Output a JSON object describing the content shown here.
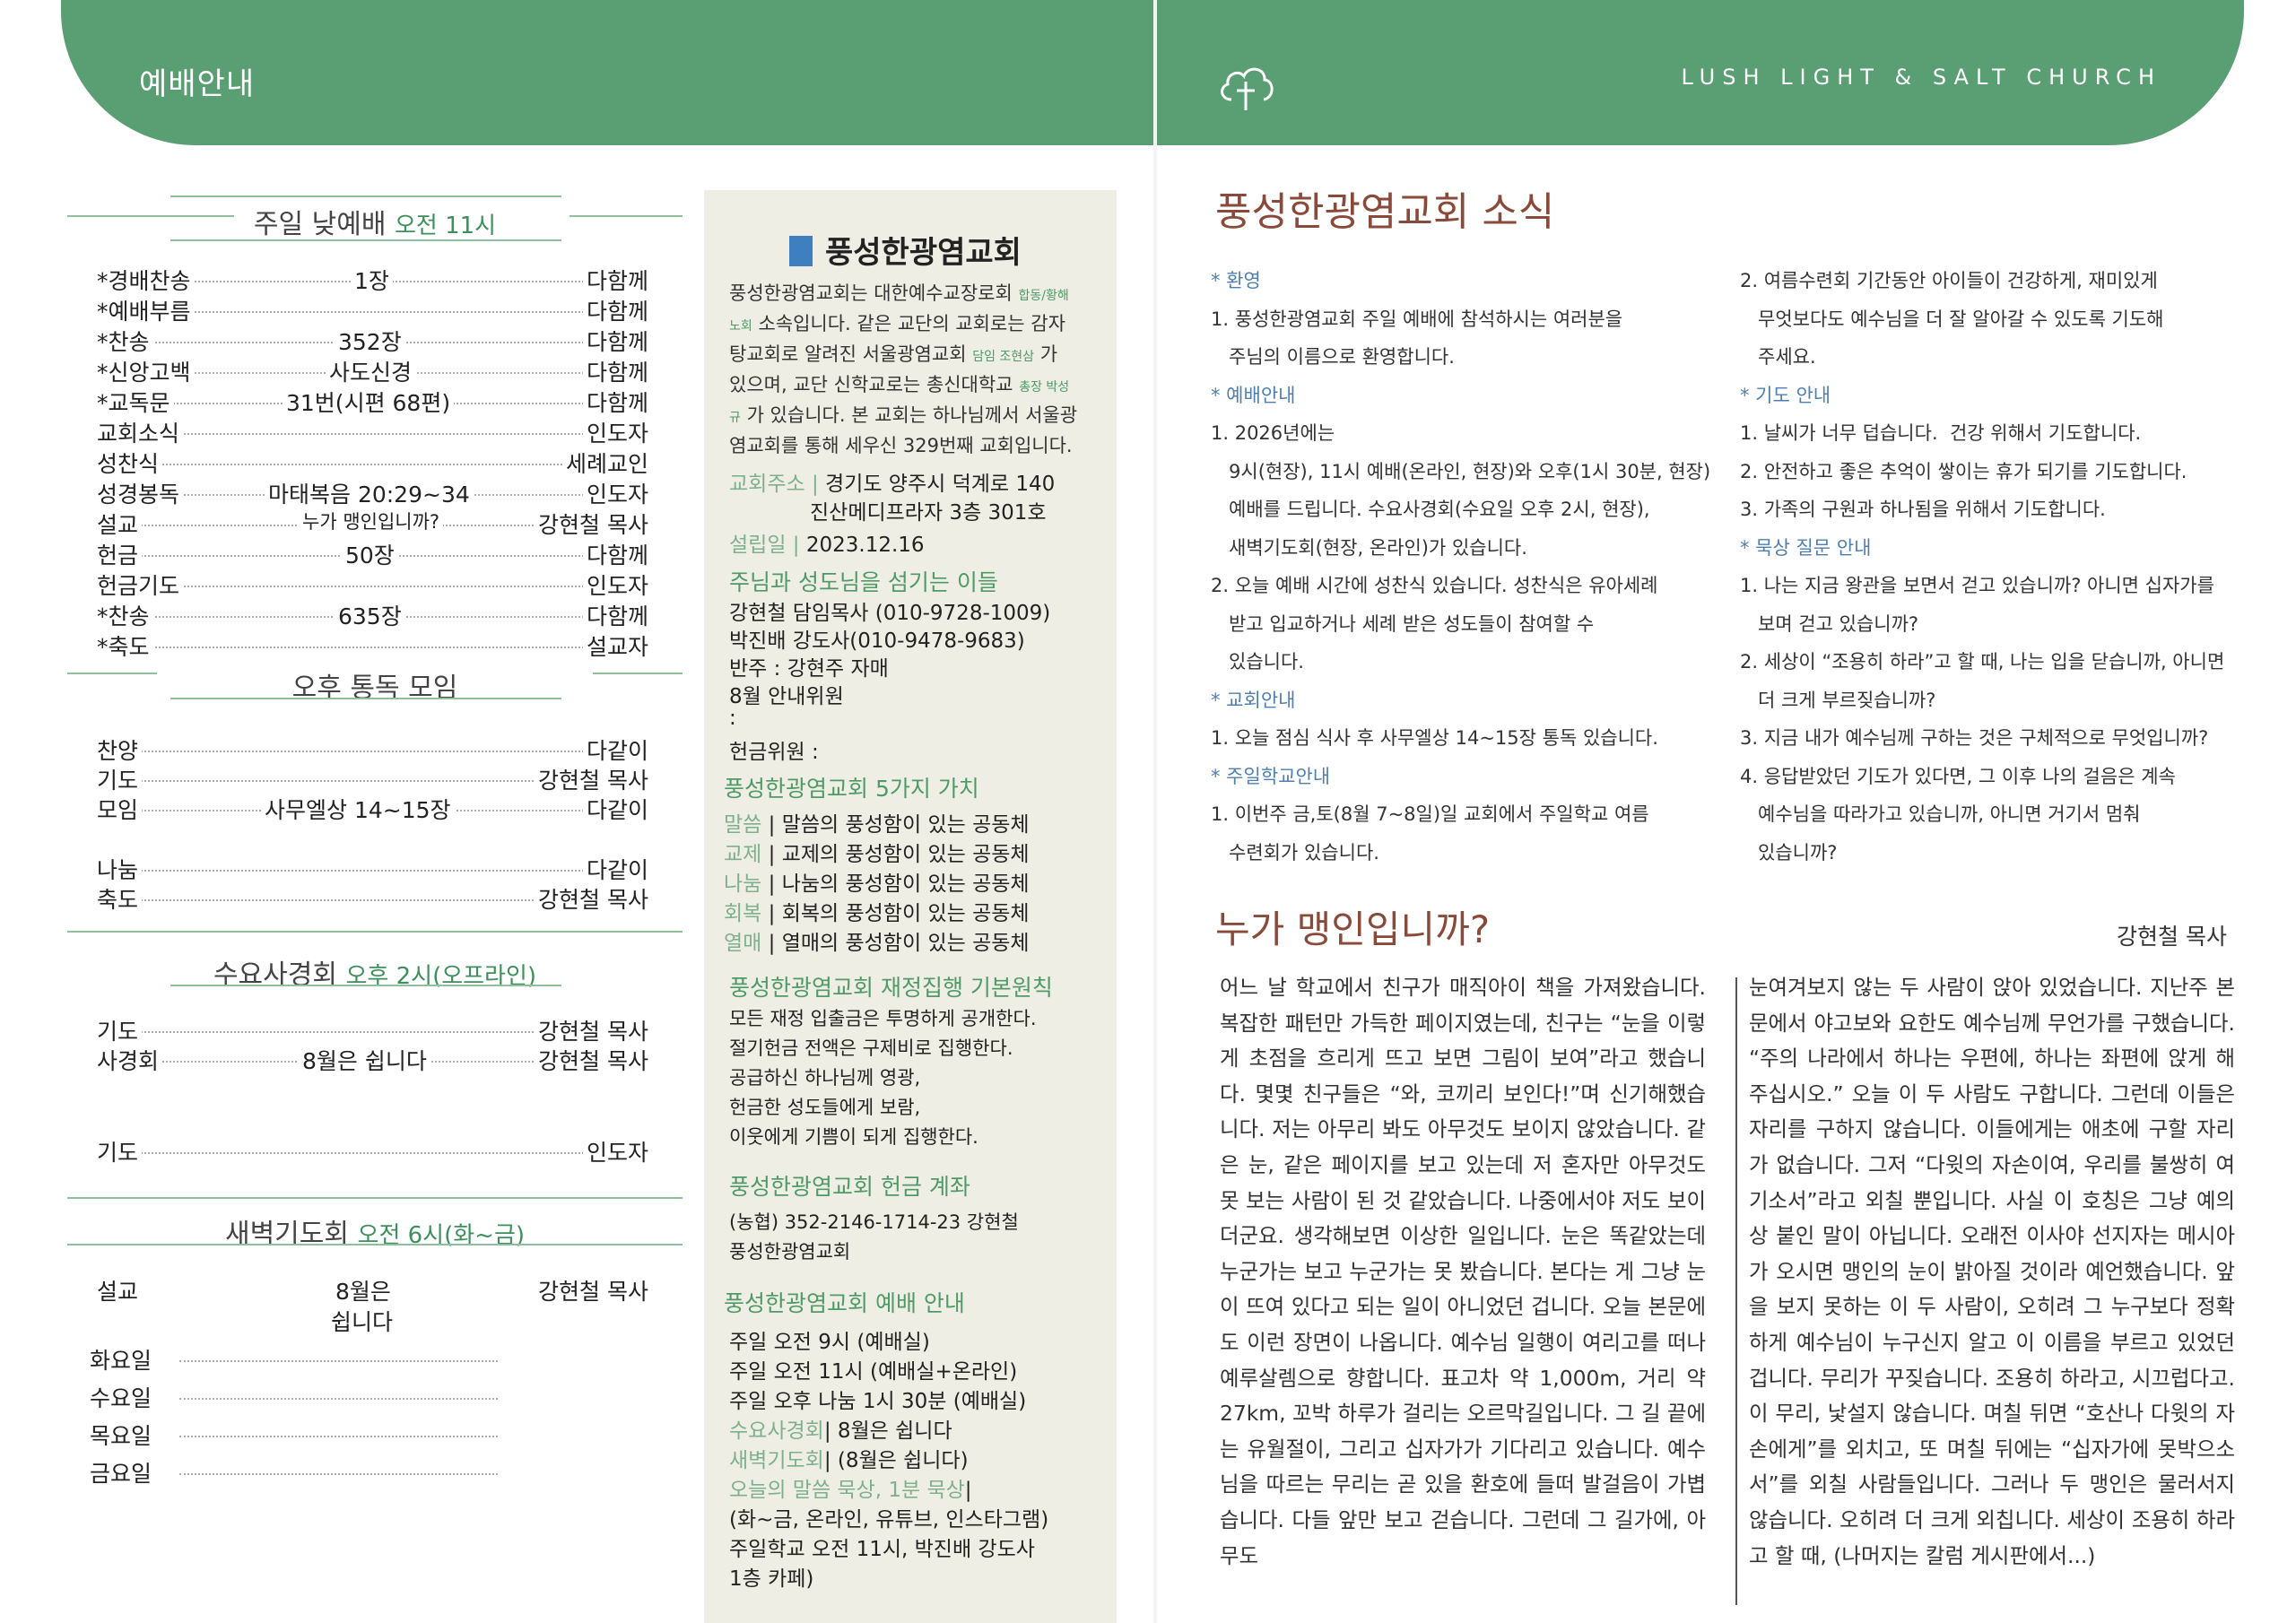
{
  "header": {
    "left_label": "예배안내",
    "church_en": "LUSH LIGHT & SALT CHURCH"
  },
  "sunday": {
    "title": "주일 낮예배",
    "time": "오전 11시",
    "rows": [
      {
        "l": "*경배찬송",
        "m": "1장",
        "r": "다함께"
      },
      {
        "l": "*예배부름",
        "m": "",
        "r": "다함께"
      },
      {
        "l": "*찬송",
        "m": "352장",
        "r": "다함께"
      },
      {
        "l": "*신앙고백",
        "m": "사도신경",
        "r": "다함께"
      },
      {
        "l": "*교독문",
        "m": "31번(시편 68편)",
        "r": "다함께"
      },
      {
        "l": "교회소식",
        "m": "",
        "r": "인도자"
      },
      {
        "l": "성찬식",
        "m": "",
        "r": "세례교인"
      },
      {
        "l": "성경봉독",
        "m": "마태복음 20:29~34",
        "r": "인도자"
      },
      {
        "l": "설교",
        "m": "누가 맹인입니까?",
        "r": "강현철 목사"
      },
      {
        "l": "헌금",
        "m": "50장",
        "r": "다함께"
      },
      {
        "l": "헌금기도",
        "m": "",
        "r": "인도자"
      },
      {
        "l": "*찬송",
        "m": "635장",
        "r": "다함께"
      },
      {
        "l": "*축도",
        "m": "",
        "r": "설교자"
      }
    ]
  },
  "afternoon": {
    "title": "오후 통독 모임",
    "rows": [
      {
        "l": "찬양",
        "m": "",
        "r": "다같이"
      },
      {
        "l": "기도",
        "m": "",
        "r": "강현철 목사"
      },
      {
        "l": "모임",
        "m": "사무엘상 14~15장",
        "r": "다같이"
      },
      {
        "l": "나눔",
        "m": "",
        "r": "다같이"
      },
      {
        "l": "축도",
        "m": "",
        "r": "강현철 목사"
      }
    ]
  },
  "wednesday": {
    "title": "수요사경회",
    "time": "오후 2시(오프라인)",
    "rows": [
      {
        "l": "기도",
        "m": "",
        "r": "강현철 목사"
      },
      {
        "l": "사경회",
        "m": "8월은 쉽니다",
        "r": "강현철 목사"
      },
      {
        "l": "기도",
        "m": "",
        "r": "인도자"
      }
    ]
  },
  "dawn": {
    "title": "새벽기도회",
    "time": "오전 6시(화~금)",
    "sermon": {
      "l": "설교",
      "m1": "8월은",
      "m2": "쉽니다",
      "r": "강현철 목사"
    },
    "days": [
      "화요일",
      "수요일",
      "목요일",
      "금요일"
    ]
  },
  "middle": {
    "logo": "풍성한광염교회",
    "intro": [
      {
        "t": "풍성한광염교회는 대한예수교장로회 ",
        "s": "합동/황해"
      },
      {
        "t": "",
        "s": "노회",
        "t2": " 소속입니다. 같은 교단의 교회로는 감자"
      },
      {
        "t": "탕교회로 알려진 서울광염교회 ",
        "s": "담임 조현삼",
        "t2": " 가"
      },
      {
        "t": "있으며, 교단 신학교로는 총신대학교 ",
        "s": "총장 박성"
      },
      {
        "t": "",
        "s": "규",
        "t2": " 가 있습니다. 본 교회는 하나님께서 서울광"
      },
      {
        "t": "염교회를 통해 세우신 329번째 교회입니다."
      }
    ],
    "address_label": "교회주소 |",
    "address1": "경기도 양주시 덕계로 140",
    "address2": "진산메디프라자 3층 301호",
    "founded_label": "설립일 |",
    "founded": "2023.12.16",
    "servants_title": "주님과 성도님을 섬기는 이들",
    "servants": [
      "강현철 담임목사 (010-9728-1009)",
      "박진배 강도사(010-9478-9683)",
      "반주 : 강현주 자매",
      "8월 안내위원",
      ":",
      "헌금위원 :"
    ],
    "values_title": "풍성한광염교회 5가지 가치",
    "values": [
      {
        "k": "말씀",
        "v": "| 말씀의 풍성함이 있는 공동체"
      },
      {
        "k": "교제",
        "v": "| 교제의 풍성함이 있는 공동체"
      },
      {
        "k": "나눔",
        "v": "| 나눔의 풍성함이 있는 공동체"
      },
      {
        "k": "회복",
        "v": "| 회복의 풍성함이 있는 공동체"
      },
      {
        "k": "열매",
        "v": "| 열매의 풍성함이 있는 공동체"
      }
    ],
    "finance_title": "풍성한광염교회 재정집행 기본원칙",
    "finance": [
      "모든 재정 입출금은 투명하게 공개한다.",
      "절기헌금 전액은 구제비로 집행한다.",
      "공급하신 하나님께 영광,",
      "헌금한 성도들에게 보람,",
      "이웃에게 기쁨이 되게 집행한다."
    ],
    "account_title": "풍성한광염교회 헌금 계좌",
    "account": [
      "(농협) 352-2146-1714-23 강현철",
      "풍성한광염교회"
    ],
    "worship_title": "풍성한광염교회 예배 안내",
    "worship": [
      {
        "k": "",
        "v": "주일 오전 9시 (예배실)"
      },
      {
        "k": "",
        "v": "주일 오전 11시 (예배실+온라인)"
      },
      {
        "k": "",
        "v": "주일 오후 나눔 1시 30분 (예배실)"
      },
      {
        "k": "수요사경회",
        "v": "| 8월은 쉽니다"
      },
      {
        "k": "새벽기도회",
        "v": "| (8월은 쉽니다)"
      },
      {
        "k": "오늘의 말씀 묵상, 1분 묵상",
        "v": "|"
      },
      {
        "k": "",
        "v": "(화~금, 온라인, 유튜브, 인스타그램)"
      },
      {
        "k": "",
        "v": "주일학교 오전 11시, 박진배 강도사"
      },
      {
        "k": "",
        "v": "1층 카페)"
      }
    ]
  },
  "news": {
    "title": "풍성한광염교회 소식",
    "left": [
      {
        "h": "* 환영"
      },
      {
        "t": "1. 풍성한광염교회 주일 예배에 참석하시는 여러분을"
      },
      {
        "t": "   주님의 이름으로 환영합니다."
      },
      {
        "h": "* 예배안내"
      },
      {
        "t": "1. 2026년에는"
      },
      {
        "t": "   9시(현장), 11시 예배(온라인, 현장)와 오후(1시 30분, 현장)"
      },
      {
        "t": "   예배를 드립니다. 수요사경회(수요일 오후 2시, 현장),"
      },
      {
        "t": "   새벽기도회(현장, 온라인)가 있습니다."
      },
      {
        "t": "2. 오늘 예배 시간에 성찬식 있습니다. 성찬식은 유아세례"
      },
      {
        "t": "   받고 입교하거나 세례 받은 성도들이 참여할 수"
      },
      {
        "t": "   있습니다."
      },
      {
        "h": "* 교회안내"
      },
      {
        "t": "1. 오늘 점심 식사 후 사무엘상 14~15장 통독 있습니다."
      },
      {
        "h": "* 주일학교안내"
      },
      {
        "t": "1. 이번주 금,토(8월 7~8일)일 교회에서 주일학교 여름"
      },
      {
        "t": "   수련회가 있습니다."
      }
    ],
    "right": [
      {
        "t": "2. 여름수련회 기간동안 아이들이 건강하게, 재미있게"
      },
      {
        "t": "   무엇보다도 예수님을 더 잘 알아갈 수 있도록 기도해"
      },
      {
        "t": "   주세요."
      },
      {
        "h": "* 기도 안내"
      },
      {
        "t": "1. 날씨가 너무 덥습니다.  건강 위해서 기도합니다."
      },
      {
        "t": "2. 안전하고 좋은 추억이 쌓이는 휴가 되기를 기도합니다."
      },
      {
        "t": "3. 가족의 구원과 하나됨을 위해서 기도합니다."
      },
      {
        "h": "* 묵상 질문 안내"
      },
      {
        "t": "1. 나는 지금 왕관을 보면서 걷고 있습니까? 아니면 십자가를"
      },
      {
        "t": "   보며 걷고 있습니까?"
      },
      {
        "t": "2. 세상이 “조용히 하라”고 할 때, 나는 입을 닫습니까, 아니면"
      },
      {
        "t": "   더 크게 부르짖습니까?"
      },
      {
        "t": "3. 지금 내가 예수님께 구하는 것은 구체적으로 무엇입니까?"
      },
      {
        "t": "4. 응답받았던 기도가 있다면, 그 이후 나의 걸음은 계속"
      },
      {
        "t": "   예수님을 따라가고 있습니까, 아니면 거기서 멈춰"
      },
      {
        "t": "   있습니까?"
      }
    ]
  },
  "sermon": {
    "title": "누가 맹인입니까?",
    "author": "강현철 목사",
    "col1": "어느 날 학교에서 친구가 매직아이 책을 가져왔습니다. 복잡한 패턴만 가득한 페이지였는데, 친구는 “눈을 이렇게 초점을 흐리게 뜨고 보면 그림이 보여”라고 했습니다. 몇몇 친구들은 “와, 코끼리 보인다!”며 신기해했습니다. 저는 아무리 봐도 아무것도 보이지 않았습니다. 같은 눈, 같은 페이지를 보고 있는데 저 혼자만 아무것도 못 보는 사람이 된 것 같았습니다. 나중에서야 저도 보이더군요. 생각해보면 이상한 일입니다. 눈은 똑같았는데 누군가는 보고 누군가는 못 봤습니다. 본다는 게 그냥 눈이 뜨여 있다고 되는 일이 아니었던 겁니다. 오늘 본문에도 이런 장면이 나옵니다. 예수님 일행이 여리고를 떠나 예루살렘으로 향합니다. 표고차 약 1,000m, 거리 약 27km, 꼬박 하루가 걸리는 오르막길입니다. 그 길 끝에는 유월절이, 그리고 십자가가 기다리고 있습니다. 예수님을 따르는 무리는 곧 있을 환호에 들떠 발걸음이 가볍습니다. 다들 앞만 보고 걷습니다. 그런데 그 길가에, 아무도",
    "col2": "눈여겨보지 않는 두 사람이 앉아 있었습니다. 지난주 본문에서 야고보와 요한도 예수님께 무언가를 구했습니다. “주의 나라에서 하나는 우편에, 하나는 좌편에 앉게 해주십시오.” 오늘 이 두 사람도 구합니다. 그런데 이들은 자리를 구하지 않습니다. 이들에게는 애초에 구할 자리가 없습니다. 그저 “다윗의 자손이여, 우리를 불쌍히 여기소서”라고 외칠 뿐입니다. 사실 이 호칭은 그냥 예의상 붙인 말이 아닙니다. 오래전 이사야 선지자는 메시아가 오시면 맹인의 눈이 밝아질 것이라 예언했습니다. 앞을 보지 못하는 이 두 사람이, 오히려 그 누구보다 정확하게 예수님이 누구신지 알고 이 이름을 부르고 있었던 겁니다. 무리가 꾸짖습니다. 조용히 하라고, 시끄럽다고. 이 무리, 낯설지 않습니다. 며칠 뒤면 “호산나 다윗의 자손에게”를 외치고, 또 며칠 뒤에는 “십자가에 못박으소서”를 외칠 사람들입니다. 그러나 두 맹인은 물러서지 않습니다. 오히려 더 크게 외칩니다. 세상이 조용히 하라고 할 때, (나머지는 칼럼 게시판에서...)"
  }
}
